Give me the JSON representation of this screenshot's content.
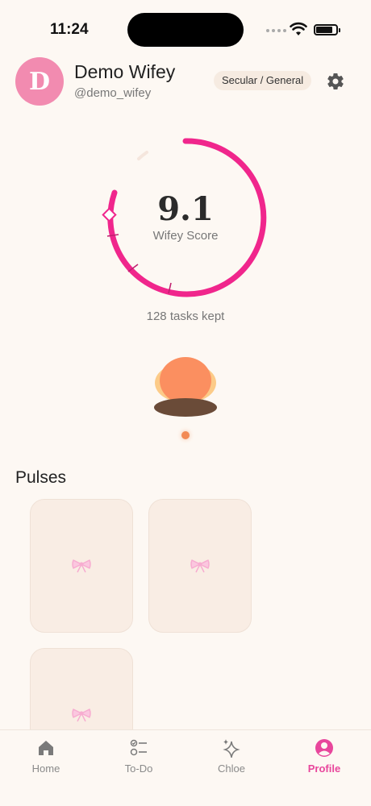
{
  "status_bar": {
    "time": "11:24"
  },
  "profile": {
    "avatar_initial": "D",
    "display_name": "Demo Wifey",
    "handle": "@demo_wifey",
    "badge": "Secular / General"
  },
  "score": {
    "value": "9.1",
    "label": "Wifey Score",
    "tasks_kept": "128 tasks kept",
    "ring_fill_fraction": 0.91
  },
  "pulses": {
    "title": "Pulses",
    "cards": [
      "pulse-1",
      "pulse-2",
      "pulse-3"
    ]
  },
  "tab_bar": {
    "tabs": [
      {
        "label": "Home",
        "icon": "home-icon"
      },
      {
        "label": "To-Do",
        "icon": "checklist-icon"
      },
      {
        "label": "Chloe",
        "icon": "sparkle-icon"
      },
      {
        "label": "Profile",
        "icon": "profile-icon",
        "active": true
      }
    ]
  },
  "colors": {
    "accent": "#f0268c",
    "avatar": "#f28bb0",
    "background": "#fdf8f3",
    "card": "#f9ede4"
  }
}
